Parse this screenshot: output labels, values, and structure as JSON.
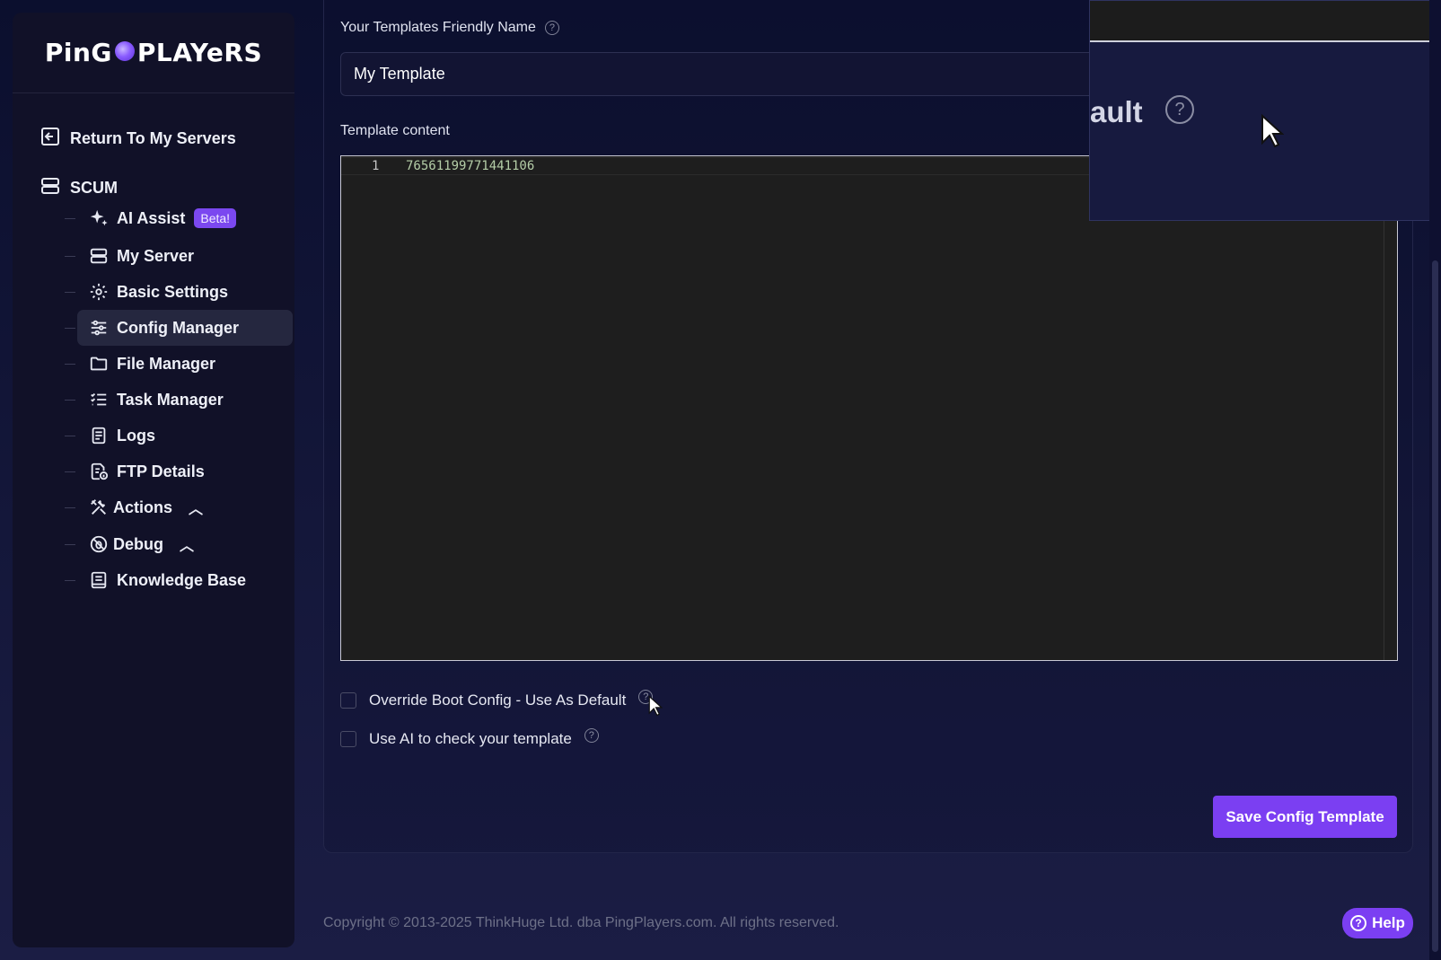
{
  "brand": {
    "logo_text_left": "PinG",
    "logo_text_right": "PLAYeRS"
  },
  "sidebar": {
    "return_label": "Return To My Servers",
    "game_label": "SCUM",
    "items": [
      {
        "label": "AI Assist",
        "icon": "sparkle-icon",
        "badge": "Beta!"
      },
      {
        "label": "My Server",
        "icon": "server-icon"
      },
      {
        "label": "Basic Settings",
        "icon": "gear-icon"
      },
      {
        "label": "Config Manager",
        "icon": "sliders-icon",
        "active": true
      },
      {
        "label": "File Manager",
        "icon": "folder-icon"
      },
      {
        "label": "Task Manager",
        "icon": "checklist-icon"
      },
      {
        "label": "Logs",
        "icon": "document-icon"
      },
      {
        "label": "FTP Details",
        "icon": "file-info-icon"
      },
      {
        "label": "Actions",
        "icon": "tools-icon",
        "expandable": true
      },
      {
        "label": "Debug",
        "icon": "bug-icon",
        "expandable": true
      },
      {
        "label": "Knowledge Base",
        "icon": "book-icon"
      }
    ]
  },
  "form": {
    "name_label": "Your Templates Friendly Name",
    "name_value": "My Template",
    "content_label": "Template content",
    "editor_line_number": "1",
    "editor_line_content": "76561199771441106",
    "override_label": "Override Boot Config - Use As Default",
    "ai_check_label": "Use AI to check your template",
    "save_label": "Save Config Template"
  },
  "zoom_overlay": {
    "text": "ault"
  },
  "footer": {
    "copyright": "Copyright © 2013-2025 ThinkHuge Ltd. dba PingPlayers.com. All rights reserved.",
    "help_label": "Help"
  },
  "colors": {
    "accent": "#7b3ff2",
    "sidebar_bg": "#111128",
    "editor_bg": "#1e1e1e",
    "code_text": "#b5cea8"
  }
}
